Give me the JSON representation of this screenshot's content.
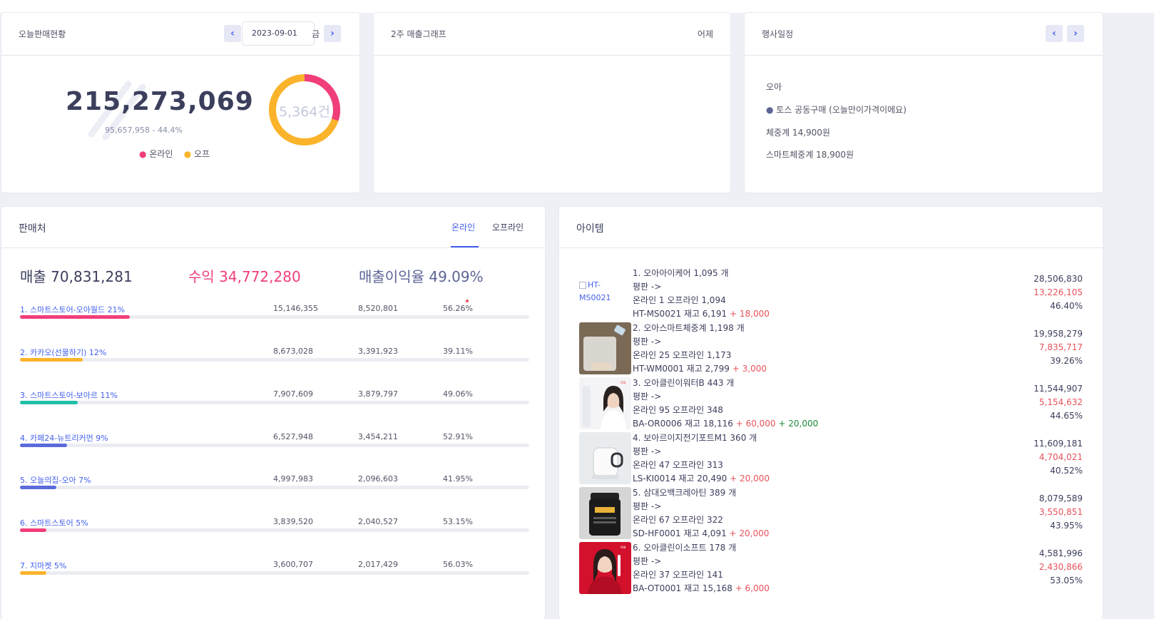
{
  "today": {
    "title": "오늘판매현황",
    "date": "2023-09-01",
    "weekday": "금",
    "prev_icon": "chevron-left-icon",
    "next_icon": "chevron-right-icon",
    "total": "215,273,069",
    "sub": "95,657,958 - 44.4%",
    "donut_label": "5,364건",
    "donut_online_fraction": 0.3,
    "legend_online": "온라인",
    "legend_offline": "오프",
    "color_online": "#f03e7a",
    "color_offline": "#fbb32b"
  },
  "graph": {
    "title": "2주 매출그래프",
    "link": "어제"
  },
  "events": {
    "title": "행사일정",
    "brand": "오아",
    "event_title": "토스 공동구매 (오늘만이가격이에요)",
    "items": [
      "체중계 14,900원",
      "스마트체중계 18,900원"
    ]
  },
  "sellers": {
    "title": "판매처",
    "tab_online": "온라인",
    "tab_offline": "오프라인",
    "sales_label": "매출",
    "sales_value": "70,831,281",
    "profit_label": "수익",
    "profit_value": "34,772,280",
    "margin_label": "매출이익율",
    "margin_value": "49.09%",
    "rows": [
      {
        "name": "1. 스마트스토어-오아월드 21%",
        "sales": "15,146,355",
        "profit": "8,520,801",
        "rate": "56.26%",
        "pct": 21,
        "color": "#f03e7a"
      },
      {
        "name": "2. 카카오(선물하기) 12%",
        "sales": "8,673,028",
        "profit": "3,391,923",
        "rate": "39.11%",
        "pct": 12,
        "color": "#fbb32b"
      },
      {
        "name": "3. 스마트스토어-보아르 11%",
        "sales": "7,907,609",
        "profit": "3,879,797",
        "rate": "49.06%",
        "pct": 11,
        "color": "#1fbfa8"
      },
      {
        "name": "4. 카페24-뉴트리커먼 9%",
        "sales": "6,527,948",
        "profit": "3,454,211",
        "rate": "52.91%",
        "pct": 9,
        "color": "#5b6bdc"
      },
      {
        "name": "5. 오늘의집-오아 7%",
        "sales": "4,997,983",
        "profit": "2,096,603",
        "rate": "41.95%",
        "pct": 7,
        "color": "#5b6bdc"
      },
      {
        "name": "6. 스마트스토어 5%",
        "sales": "3,839,520",
        "profit": "2,040,527",
        "rate": "53.15%",
        "pct": 5,
        "color": "#f03e7a"
      },
      {
        "name": "7. 지마켓 5%",
        "sales": "3,600,707",
        "profit": "2,017,429",
        "rate": "56.03%",
        "pct": 5,
        "color": "#fbb32b"
      }
    ]
  },
  "items": {
    "title": "아이템",
    "list": [
      {
        "title": "1. 오아아이케어 1,095 개",
        "review": "평판 ->",
        "channels": "온라인 1 오프라인 1,094",
        "stock": "HT-MS0021 재고 6,191",
        "extra": "+ 18,000",
        "extra2": "",
        "sales": "28,506,830",
        "profit": "13,226,105",
        "rate": "46.40%",
        "img_alt": "HT-MS0021",
        "img": "broken"
      },
      {
        "title": "2. 오아스마트체중계 1,198 개",
        "review": "평판 ->",
        "channels": "온라인 25 오프라인 1,173",
        "stock": "HT-WM0001 재고 2,799",
        "extra": "+ 3,000",
        "extra2": "",
        "sales": "19,958,279",
        "profit": "7,835,717",
        "rate": "39.26%",
        "img_alt": "",
        "img": "scale"
      },
      {
        "title": "3. 오아클린이워터B 443 개",
        "review": "평판 ->",
        "channels": "온라인 95 오프라인 348",
        "stock": "BA-OR0006 재고 18,116",
        "extra": "+ 60,000",
        "extra2": "+ 20,000",
        "sales": "11,544,907",
        "profit": "5,154,632",
        "rate": "44.65%",
        "img_alt": "",
        "img": "woman-white"
      },
      {
        "title": "4. 보아르이지전기포트M1 360 개",
        "review": "평판 ->",
        "channels": "온라인 47 오프라인 313",
        "stock": "LS-KI0014 재고 20,490",
        "extra": "+ 20,000",
        "extra2": "",
        "sales": "11,609,181",
        "profit": "4,704,021",
        "rate": "40.52%",
        "img_alt": "",
        "img": "kettle"
      },
      {
        "title": "5. 삼대오백크레아틴 389 개",
        "review": "평판 ->",
        "channels": "온라인 67 오프라인 322",
        "stock": "SD-HF0001 재고 4,091",
        "extra": "+ 20,000",
        "extra2": "",
        "sales": "8,079,589",
        "profit": "3,550,851",
        "rate": "43.95%",
        "img_alt": "",
        "img": "jar"
      },
      {
        "title": "6. 오아클린이소프트 178 개",
        "review": "평판 ->",
        "channels": "온라인 37 오프라인 141",
        "stock": "BA-OT0001 재고 15,168",
        "extra": "+ 6,000",
        "extra2": "",
        "sales": "4,581,996",
        "profit": "2,430,866",
        "rate": "53.05%",
        "img_alt": "",
        "img": "woman-red"
      }
    ]
  }
}
